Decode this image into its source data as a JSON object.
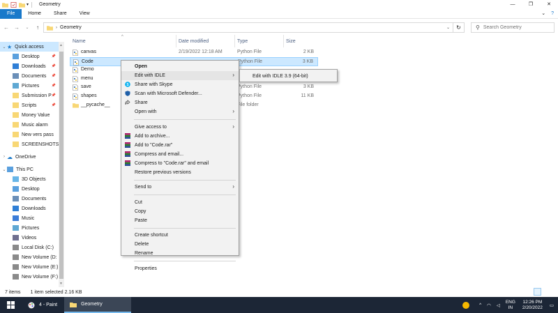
{
  "window": {
    "title": "Geometry",
    "controls": [
      "—",
      "❐",
      "✕"
    ]
  },
  "ribbon": {
    "tabs": [
      "File",
      "Home",
      "Share",
      "View"
    ],
    "right_icons": [
      "chevron-down-icon",
      "help-icon"
    ]
  },
  "address": {
    "path": "Geometry",
    "search_placeholder": "Search Geometry"
  },
  "nav_pane": {
    "quick_access_label": "Quick access",
    "quick_access": [
      {
        "label": "Desktop",
        "icon": "desktop-icon",
        "pinned": true
      },
      {
        "label": "Downloads",
        "icon": "downloads-icon",
        "pinned": true
      },
      {
        "label": "Documents",
        "icon": "documents-icon",
        "pinned": true
      },
      {
        "label": "Pictures",
        "icon": "pictures-icon",
        "pinned": true
      },
      {
        "label": "Submission P",
        "icon": "folder-icon",
        "pinned": true
      },
      {
        "label": "Scripts",
        "icon": "folder-icon",
        "pinned": true
      },
      {
        "label": "Money Value",
        "icon": "folder-icon",
        "pinned": false
      },
      {
        "label": "Music alarm",
        "icon": "folder-icon",
        "pinned": false
      },
      {
        "label": "New vers pass",
        "icon": "folder-icon",
        "pinned": false
      },
      {
        "label": "SCREENSHOTS",
        "icon": "folder-icon",
        "pinned": false
      }
    ],
    "onedrive_label": "OneDrive",
    "this_pc_label": "This PC",
    "this_pc": [
      {
        "label": "3D Objects",
        "icon": "3d-objects-icon"
      },
      {
        "label": "Desktop",
        "icon": "desktop-icon"
      },
      {
        "label": "Documents",
        "icon": "documents-icon"
      },
      {
        "label": "Downloads",
        "icon": "downloads-icon"
      },
      {
        "label": "Music",
        "icon": "music-icon"
      },
      {
        "label": "Pictures",
        "icon": "pictures-icon"
      },
      {
        "label": "Videos",
        "icon": "videos-icon"
      },
      {
        "label": "Local Disk (C:)",
        "icon": "drive-icon"
      },
      {
        "label": "New Volume (D:",
        "icon": "drive-icon"
      },
      {
        "label": "New Volume (E:)",
        "icon": "drive-icon"
      },
      {
        "label": "New Volume (F:)",
        "icon": "drive-icon"
      }
    ]
  },
  "columns": {
    "name": "Name",
    "date": "Date modified",
    "type": "Type",
    "size": "Size"
  },
  "files": [
    {
      "name": "canvas",
      "date": "2/19/2022 12:18 AM",
      "type": "Python File",
      "size": "2 KB",
      "icon": "python-file-icon"
    },
    {
      "name": "Code",
      "date": "",
      "type": "Python File",
      "size": "3 KB",
      "icon": "python-file-icon",
      "selected": true
    },
    {
      "name": "Demo",
      "date": "",
      "type": "",
      "size": "",
      "icon": "python-file-icon"
    },
    {
      "name": "menu",
      "date": "",
      "type": "",
      "size": "",
      "icon": "python-file-icon"
    },
    {
      "name": "save",
      "date": "",
      "type": "Python File",
      "size": "3 KB",
      "icon": "python-file-icon"
    },
    {
      "name": "shapes",
      "date": "",
      "type": "Python File",
      "size": "11 KB",
      "icon": "python-file-icon"
    },
    {
      "name": "__pycache__",
      "date": "",
      "type": "File folder",
      "size": "",
      "icon": "folder-icon"
    }
  ],
  "context_menu": {
    "items": [
      {
        "label": "Open",
        "bold": true,
        "icon": "",
        "arrow": false
      },
      {
        "label": "Edit with IDLE",
        "icon": "",
        "arrow": true,
        "hover": true
      },
      {
        "label": "Share with Skype",
        "icon": "skype-icon",
        "arrow": false
      },
      {
        "label": "Scan with Microsoft Defender...",
        "icon": "defender-icon",
        "arrow": false
      },
      {
        "label": "Share",
        "icon": "share-icon",
        "arrow": false
      },
      {
        "label": "Open with",
        "icon": "",
        "arrow": true
      },
      {
        "separator": true
      },
      {
        "label": "Give access to",
        "icon": "",
        "arrow": true
      },
      {
        "label": "Add to archive...",
        "icon": "winrar-icon",
        "arrow": false
      },
      {
        "label": "Add to \"Code.rar\"",
        "icon": "winrar-icon",
        "arrow": false
      },
      {
        "label": "Compress and email...",
        "icon": "winrar-icon",
        "arrow": false
      },
      {
        "label": "Compress to \"Code.rar\" and email",
        "icon": "winrar-icon",
        "arrow": false
      },
      {
        "label": "Restore previous versions",
        "icon": "",
        "arrow": false
      },
      {
        "separator": true
      },
      {
        "label": "Send to",
        "icon": "",
        "arrow": true
      },
      {
        "separator": true
      },
      {
        "label": "Cut",
        "icon": "",
        "arrow": false
      },
      {
        "label": "Copy",
        "icon": "",
        "arrow": false
      },
      {
        "label": "Paste",
        "icon": "",
        "arrow": false
      },
      {
        "separator": true
      },
      {
        "label": "Create shortcut",
        "icon": "",
        "arrow": false
      },
      {
        "label": "Delete",
        "icon": "",
        "arrow": false
      },
      {
        "label": "Rename",
        "icon": "",
        "arrow": false
      },
      {
        "separator": true
      },
      {
        "label": "Properties",
        "icon": "",
        "arrow": false
      }
    ],
    "submenu": {
      "label": "Edit with IDLE 3.9 (64-bit)"
    }
  },
  "status": {
    "item_count": "7 items",
    "selection": "1 item selected  2.16 KB"
  },
  "taskbar": {
    "tasks": [
      {
        "label": "4 - Paint",
        "icon": "paint-icon",
        "active": false
      },
      {
        "label": "Geometry",
        "icon": "folder-icon",
        "active": true
      }
    ],
    "lang_top": "ENG",
    "lang_bottom": "IN",
    "time": "12:26 PM",
    "date": "2/20/2022"
  },
  "colors": {
    "accent": "#1979ca",
    "selection": "#cce8ff",
    "taskbar": "#1c2636",
    "folder": "#f8d775"
  }
}
